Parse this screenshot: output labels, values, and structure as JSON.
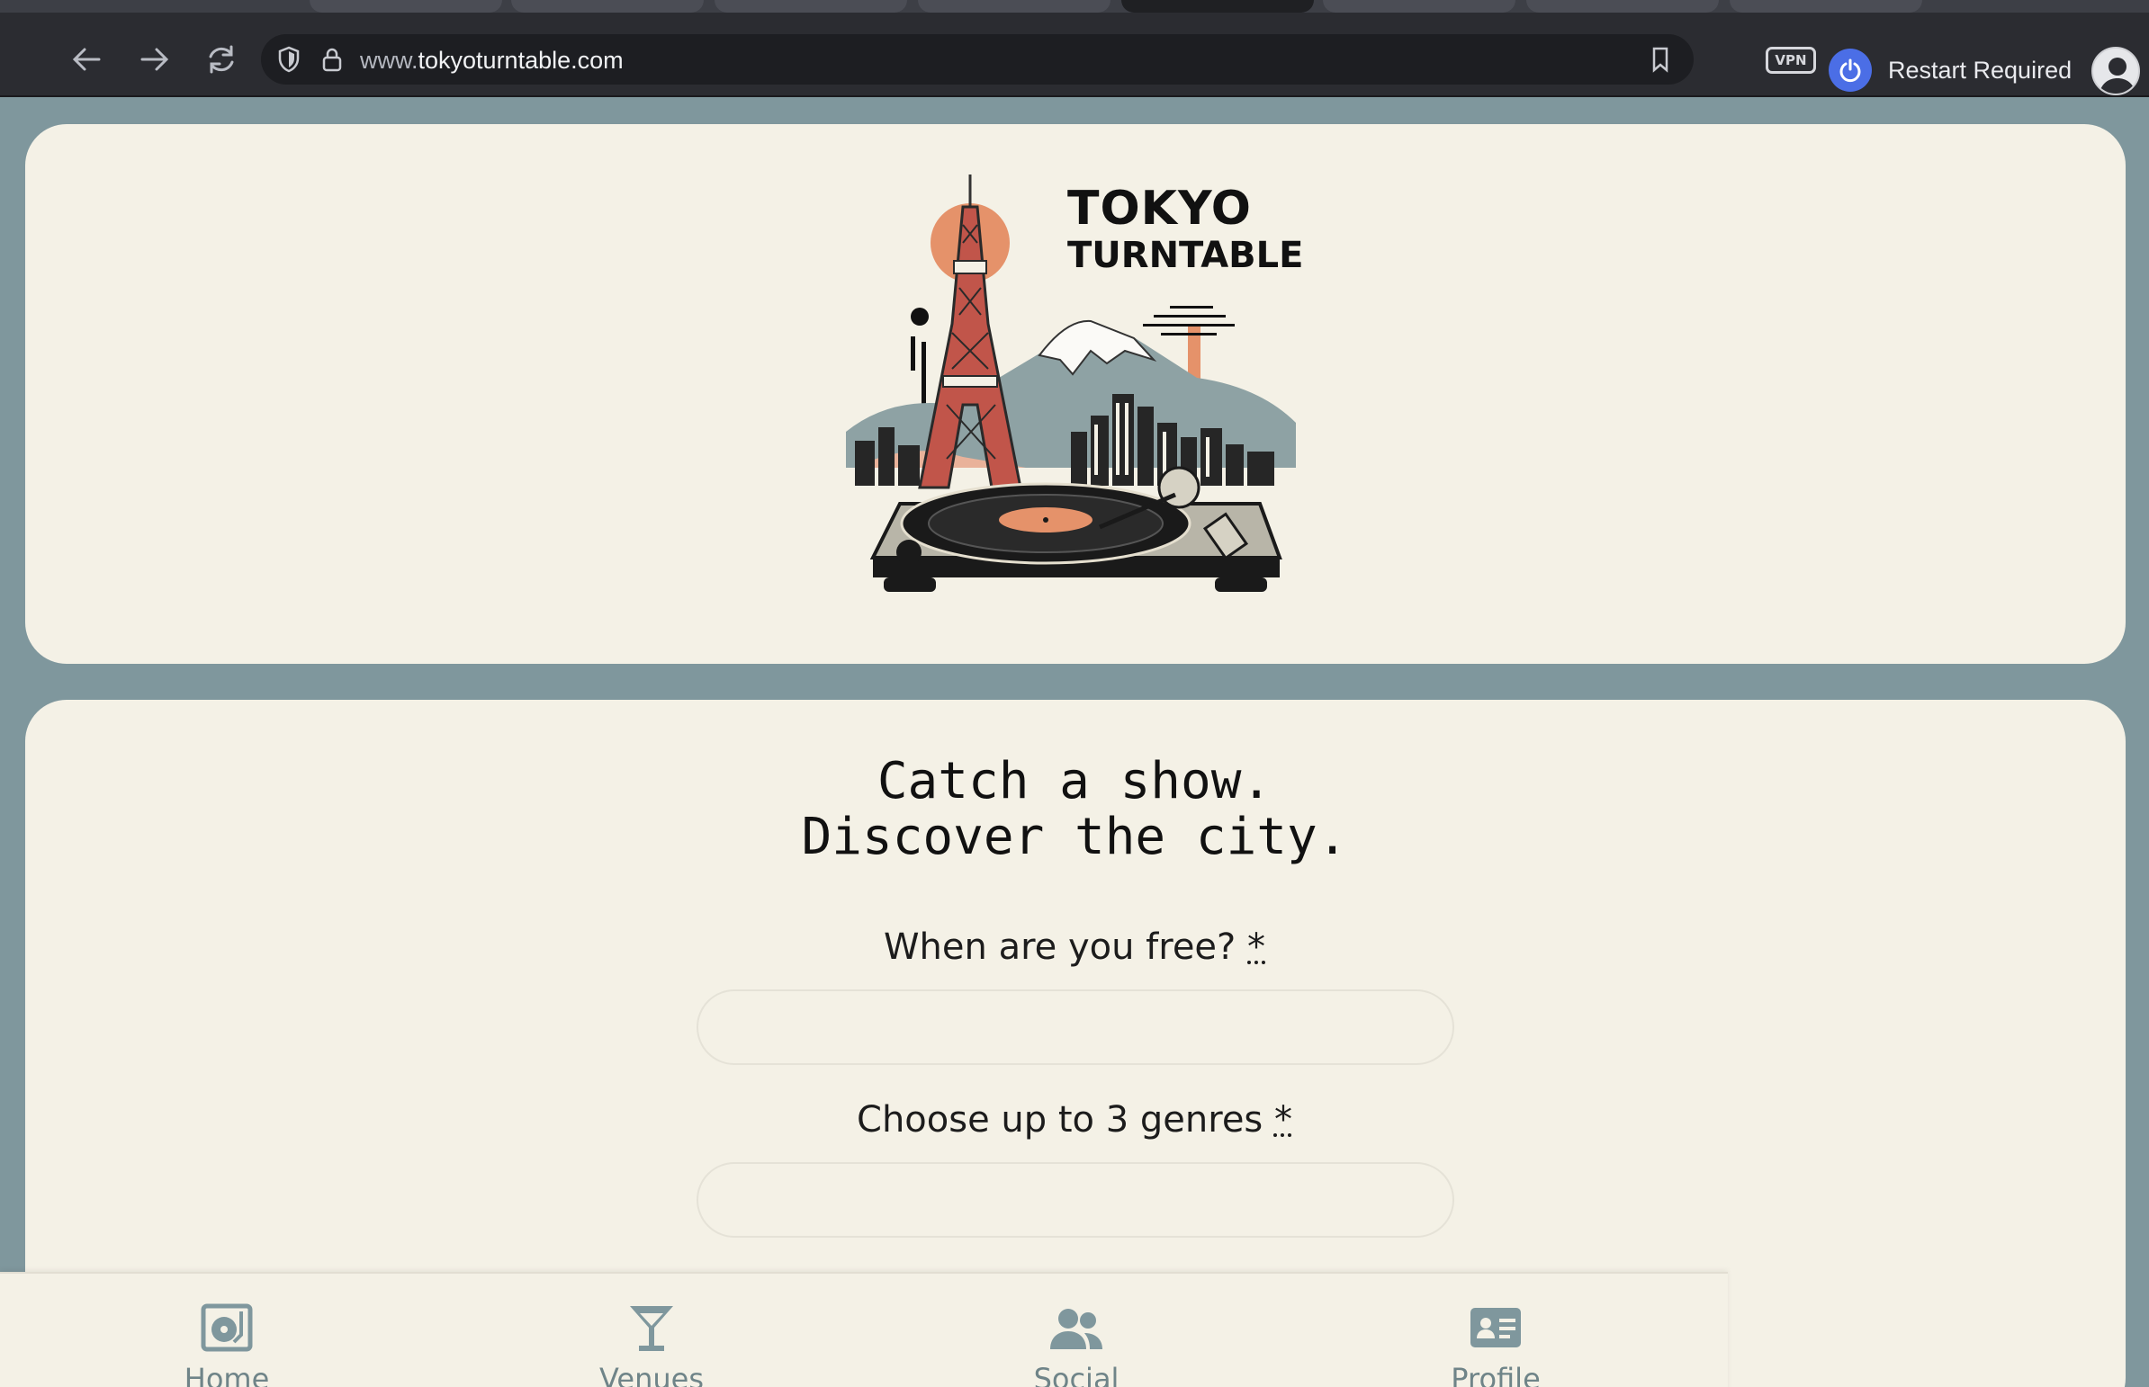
{
  "browser": {
    "url_prefix": "www.",
    "url_host": "tokyoturntable.com",
    "vpn_label": "VPN",
    "restart_label": "Restart Required"
  },
  "logo": {
    "line1": "TOKYO",
    "line2": "TURNTABLE"
  },
  "hero": {
    "headline_line1": "Catch a show.",
    "headline_line2": "Discover the city."
  },
  "form": {
    "when_label": "When are you free?",
    "genres_label": "Choose up to 3 genres",
    "required_marker": "*"
  },
  "bottom_nav": {
    "items": [
      {
        "label": "Home",
        "icon": "turntable-icon"
      },
      {
        "label": "Venues",
        "icon": "cocktail-icon"
      },
      {
        "label": "Social",
        "icon": "users-icon"
      },
      {
        "label": "Profile",
        "icon": "id-card-icon"
      }
    ]
  },
  "colors": {
    "page_bg": "#7f979d",
    "card_bg": "#f4f1e6",
    "accent_orange": "#e5926a",
    "nav_icon": "#7f979d"
  }
}
